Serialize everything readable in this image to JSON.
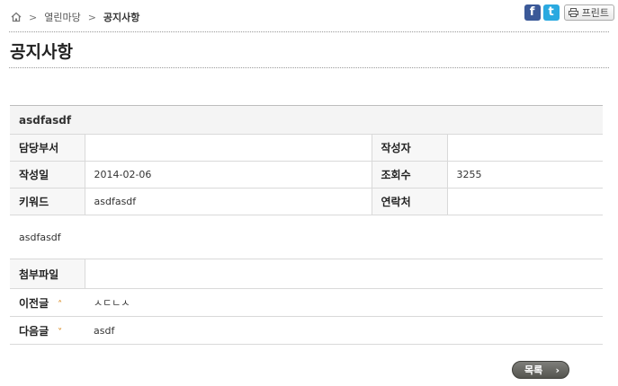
{
  "breadcrumb": {
    "items": [
      "열린마당",
      "공지사항"
    ]
  },
  "share": {
    "facebook": "f",
    "twitter": "t",
    "print_label": "프린트"
  },
  "page_title": "공지사항",
  "post": {
    "subject": "asdfasdf",
    "labels": {
      "department": "담당부서",
      "author": "작성자",
      "date": "작성일",
      "views": "조회수",
      "keyword": "키워드",
      "contact": "연락처",
      "attachment": "첨부파일",
      "prev": "이전글",
      "next": "다음글"
    },
    "department": "",
    "author": "",
    "date": "2014-02-06",
    "views": "3255",
    "keyword": "asdfasdf",
    "contact": "",
    "content": "asdfasdf",
    "attachment": "",
    "prev_title": "ㅅㄷㄴㅅ",
    "next_title": "asdf"
  },
  "list_button": {
    "label": "목록"
  },
  "colors": {
    "facebook": "#3b5998",
    "twitter": "#2aa9e0",
    "arrow": "#d98a1f",
    "button": "#55554f"
  }
}
